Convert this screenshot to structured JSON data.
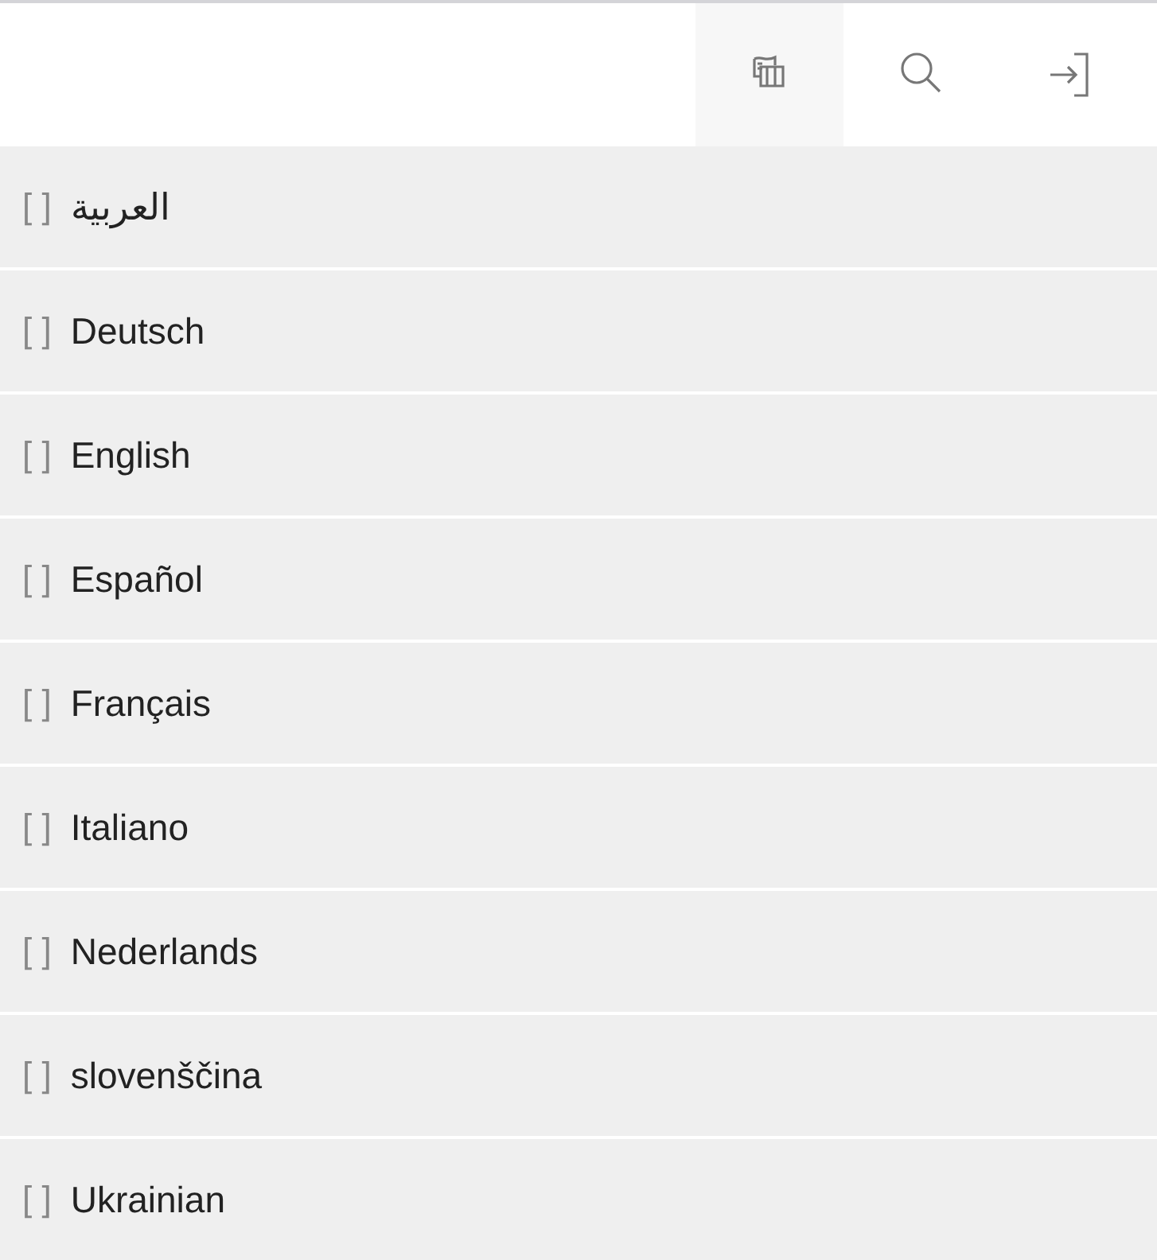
{
  "toolbar": [
    {
      "kind": "map",
      "selected": true
    },
    {
      "kind": "search",
      "selected": false
    },
    {
      "kind": "sign-in",
      "selected": false
    }
  ],
  "languages": [
    {
      "marker": "[ ]",
      "label": "العربية"
    },
    {
      "marker": "[ ]",
      "label": "Deutsch"
    },
    {
      "marker": "[ ]",
      "label": "English"
    },
    {
      "marker": "[ ]",
      "label": "Español"
    },
    {
      "marker": "[ ]",
      "label": "Français"
    },
    {
      "marker": "[ ]",
      "label": "Italiano"
    },
    {
      "marker": "[ ]",
      "label": "Nederlands"
    },
    {
      "marker": "[ ]",
      "label": "slovenščina"
    },
    {
      "marker": "[ ]",
      "label": "Ukrainian"
    }
  ]
}
